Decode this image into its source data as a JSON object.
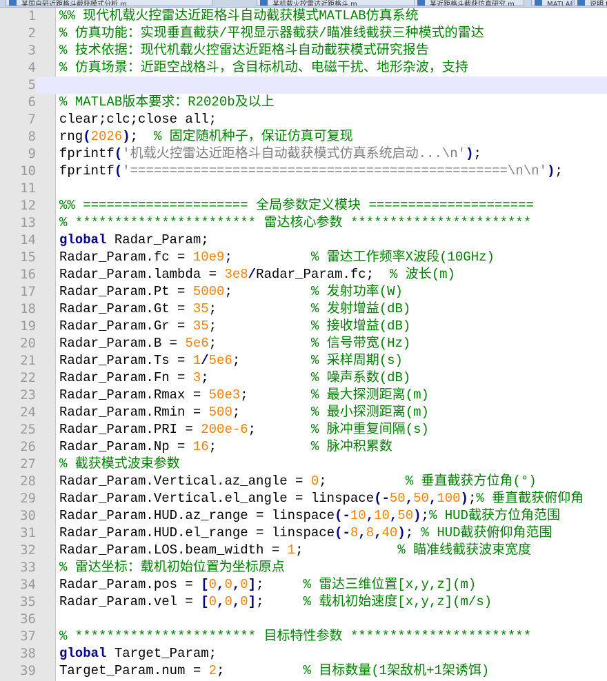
{
  "tabs": [
    {
      "label": "某国自研近距格斗截获模式分析.m"
    },
    {
      "label": "某机载火控雷达近距格斗.m"
    },
    {
      "label": "某近距格斗截获仿真研究.m"
    },
    {
      "label": "MATLAB仿真代码.m"
    },
    {
      "label": "说明.txt"
    }
  ],
  "editor": {
    "current_line": 5,
    "lines": [
      {
        "n": "1",
        "t": [
          [
            "c",
            "%% 现代机载火控雷达近距格斗自动截获模式MATLAB仿真系统"
          ]
        ]
      },
      {
        "n": "2",
        "t": [
          [
            "c",
            "% 仿真功能：实现垂直截获/平视显示器截获/瞄准线截获三种模式的雷达"
          ]
        ]
      },
      {
        "n": "3",
        "t": [
          [
            "c",
            "% 技术依据：现代机载火控雷达近距格斗自动截获模式研究报告"
          ]
        ]
      },
      {
        "n": "4",
        "t": [
          [
            "c",
            "% 仿真场景：近距空战格斗，含目标机动、电磁干扰、地形杂波，支持"
          ]
        ]
      },
      {
        "n": "5",
        "t": []
      },
      {
        "n": "6",
        "t": [
          [
            "c",
            "% MATLAB版本要求：R2020b及以上"
          ]
        ]
      },
      {
        "n": "7",
        "t": [
          [
            "p",
            "clear;clc;close all;"
          ]
        ]
      },
      {
        "n": "8",
        "t": [
          [
            "p",
            "rng"
          ],
          [
            "o",
            "("
          ],
          [
            "n",
            "2026"
          ],
          [
            "o",
            ")"
          ],
          [
            "p",
            ";  "
          ],
          [
            "c",
            "% 固定随机种子，保证仿真可复现"
          ]
        ]
      },
      {
        "n": "9",
        "t": [
          [
            "p",
            "fprintf"
          ],
          [
            "o",
            "("
          ],
          [
            "s",
            "'机载火控雷达近距格斗自动截获模式仿真系统启动...\\n'"
          ],
          [
            "o",
            ")"
          ],
          [
            "p",
            ";"
          ]
        ]
      },
      {
        "n": "10",
        "t": [
          [
            "p",
            "fprintf"
          ],
          [
            "o",
            "("
          ],
          [
            "s",
            "'================================================\\n\\n'"
          ],
          [
            "o",
            ")"
          ],
          [
            "p",
            ";"
          ]
        ]
      },
      {
        "n": "11",
        "t": []
      },
      {
        "n": "12",
        "t": [
          [
            "c",
            "%% ===================== 全局参数定义模块 ====================="
          ]
        ]
      },
      {
        "n": "13",
        "t": [
          [
            "c",
            "% *********************** 雷达核心参数 ***********************"
          ]
        ]
      },
      {
        "n": "14",
        "t": [
          [
            "k",
            "global"
          ],
          [
            "p",
            " Radar_Param;"
          ]
        ]
      },
      {
        "n": "15",
        "t": [
          [
            "p",
            "Radar_Param.fc = "
          ],
          [
            "n",
            "10e9"
          ],
          [
            "p",
            ";          "
          ],
          [
            "c",
            "% 雷达工作频率X波段(10GHz)"
          ]
        ]
      },
      {
        "n": "16",
        "t": [
          [
            "p",
            "Radar_Param.lambda = "
          ],
          [
            "n",
            "3e8"
          ],
          [
            "o",
            "/"
          ],
          [
            "p",
            "Radar_Param.fc;  "
          ],
          [
            "c",
            "% 波长(m)"
          ]
        ]
      },
      {
        "n": "17",
        "t": [
          [
            "p",
            "Radar_Param.Pt = "
          ],
          [
            "n",
            "5000"
          ],
          [
            "p",
            ";          "
          ],
          [
            "c",
            "% 发射功率(W)"
          ]
        ]
      },
      {
        "n": "18",
        "t": [
          [
            "p",
            "Radar_Param.Gt = "
          ],
          [
            "n",
            "35"
          ],
          [
            "p",
            ";            "
          ],
          [
            "c",
            "% 发射增益(dB)"
          ]
        ]
      },
      {
        "n": "19",
        "t": [
          [
            "p",
            "Radar_Param.Gr = "
          ],
          [
            "n",
            "35"
          ],
          [
            "p",
            ";            "
          ],
          [
            "c",
            "% 接收增益(dB)"
          ]
        ]
      },
      {
        "n": "20",
        "t": [
          [
            "p",
            "Radar_Param.B = "
          ],
          [
            "n",
            "5e6"
          ],
          [
            "p",
            ";            "
          ],
          [
            "c",
            "% 信号带宽(Hz)"
          ]
        ]
      },
      {
        "n": "21",
        "t": [
          [
            "p",
            "Radar_Param.Ts = "
          ],
          [
            "n",
            "1"
          ],
          [
            "o",
            "/"
          ],
          [
            "n",
            "5e6"
          ],
          [
            "p",
            ";         "
          ],
          [
            "c",
            "% 采样周期(s)"
          ]
        ]
      },
      {
        "n": "22",
        "t": [
          [
            "p",
            "Radar_Param.Fn = "
          ],
          [
            "n",
            "3"
          ],
          [
            "p",
            ";             "
          ],
          [
            "c",
            "% 噪声系数(dB)"
          ]
        ]
      },
      {
        "n": "23",
        "t": [
          [
            "p",
            "Radar_Param.Rmax = "
          ],
          [
            "n",
            "50e3"
          ],
          [
            "p",
            ";        "
          ],
          [
            "c",
            "% 最大探测距离(m)"
          ]
        ]
      },
      {
        "n": "24",
        "t": [
          [
            "p",
            "Radar_Param.Rmin = "
          ],
          [
            "n",
            "500"
          ],
          [
            "p",
            ";         "
          ],
          [
            "c",
            "% 最小探测距离(m)"
          ]
        ]
      },
      {
        "n": "25",
        "t": [
          [
            "p",
            "Radar_Param.PRI = "
          ],
          [
            "n",
            "200e-6"
          ],
          [
            "p",
            ";       "
          ],
          [
            "c",
            "% 脉冲重复间隔(s)"
          ]
        ]
      },
      {
        "n": "26",
        "t": [
          [
            "p",
            "Radar_Param.Np = "
          ],
          [
            "n",
            "16"
          ],
          [
            "p",
            ";            "
          ],
          [
            "c",
            "% 脉冲积累数"
          ]
        ]
      },
      {
        "n": "27",
        "t": [
          [
            "c",
            "% 截获模式波束参数"
          ]
        ]
      },
      {
        "n": "28",
        "t": [
          [
            "p",
            "Radar_Param.Vertical.az_angle = "
          ],
          [
            "n",
            "0"
          ],
          [
            "p",
            ";          "
          ],
          [
            "c",
            "% 垂直截获方位角(°)"
          ]
        ]
      },
      {
        "n": "29",
        "t": [
          [
            "p",
            "Radar_Param.Vertical.el_angle = linspace"
          ],
          [
            "o",
            "(-"
          ],
          [
            "n",
            "50"
          ],
          [
            "o",
            ","
          ],
          [
            "n",
            "50"
          ],
          [
            "o",
            ","
          ],
          [
            "n",
            "100"
          ],
          [
            "o",
            ")"
          ],
          [
            "p",
            ";"
          ],
          [
            "c",
            "% 垂直截获俯仰角"
          ]
        ]
      },
      {
        "n": "30",
        "t": [
          [
            "p",
            "Radar_Param.HUD.az_range = linspace"
          ],
          [
            "o",
            "(-"
          ],
          [
            "n",
            "10"
          ],
          [
            "o",
            ","
          ],
          [
            "n",
            "10"
          ],
          [
            "o",
            ","
          ],
          [
            "n",
            "50"
          ],
          [
            "o",
            ")"
          ],
          [
            "p",
            ";"
          ],
          [
            "c",
            "% HUD截获方位角范围"
          ]
        ]
      },
      {
        "n": "31",
        "t": [
          [
            "p",
            "Radar_Param.HUD.el_range = linspace"
          ],
          [
            "o",
            "(-"
          ],
          [
            "n",
            "8"
          ],
          [
            "o",
            ","
          ],
          [
            "n",
            "8"
          ],
          [
            "o",
            ","
          ],
          [
            "n",
            "40"
          ],
          [
            "o",
            ")"
          ],
          [
            "p",
            "; "
          ],
          [
            "c",
            "% HUD截获俯仰角范围"
          ]
        ]
      },
      {
        "n": "32",
        "t": [
          [
            "p",
            "Radar_Param.LOS.beam_width = "
          ],
          [
            "n",
            "1"
          ],
          [
            "p",
            ";            "
          ],
          [
            "c",
            "% 瞄准线截获波束宽度"
          ]
        ]
      },
      {
        "n": "33",
        "t": [
          [
            "c",
            "% 雷达坐标：载机初始位置为坐标原点"
          ]
        ]
      },
      {
        "n": "34",
        "t": [
          [
            "p",
            "Radar_Param.pos = "
          ],
          [
            "o",
            "["
          ],
          [
            "n",
            "0"
          ],
          [
            "o",
            ","
          ],
          [
            "n",
            "0"
          ],
          [
            "o",
            ","
          ],
          [
            "n",
            "0"
          ],
          [
            "o",
            "]"
          ],
          [
            "p",
            ";     "
          ],
          [
            "c",
            "% 雷达三维位置[x,y,z](m)"
          ]
        ]
      },
      {
        "n": "35",
        "t": [
          [
            "p",
            "Radar_Param.vel = "
          ],
          [
            "o",
            "["
          ],
          [
            "n",
            "0"
          ],
          [
            "o",
            ","
          ],
          [
            "n",
            "0"
          ],
          [
            "o",
            ","
          ],
          [
            "n",
            "0"
          ],
          [
            "o",
            "]"
          ],
          [
            "p",
            ";     "
          ],
          [
            "c",
            "% 载机初始速度[x,y,z](m/s)"
          ]
        ]
      },
      {
        "n": "36",
        "t": []
      },
      {
        "n": "37",
        "t": [
          [
            "c",
            "% *********************** 目标特性参数 ***********************"
          ]
        ]
      },
      {
        "n": "38",
        "t": [
          [
            "k",
            "global"
          ],
          [
            "p",
            " Target_Param;"
          ]
        ]
      },
      {
        "n": "39",
        "t": [
          [
            "p",
            "Target_Param.num = "
          ],
          [
            "n",
            "2"
          ],
          [
            "p",
            ";          "
          ],
          [
            "c",
            "% 目标数量(1架敌机+1架诱饵)"
          ]
        ]
      }
    ]
  },
  "colors": {
    "comment": "#008000",
    "keyword": "#00008b",
    "number": "#ff8000",
    "string": "#808080",
    "operator": "#000080",
    "current_line_bg": "#e8e8ff",
    "gutter_bg": "#e6e6e6"
  }
}
